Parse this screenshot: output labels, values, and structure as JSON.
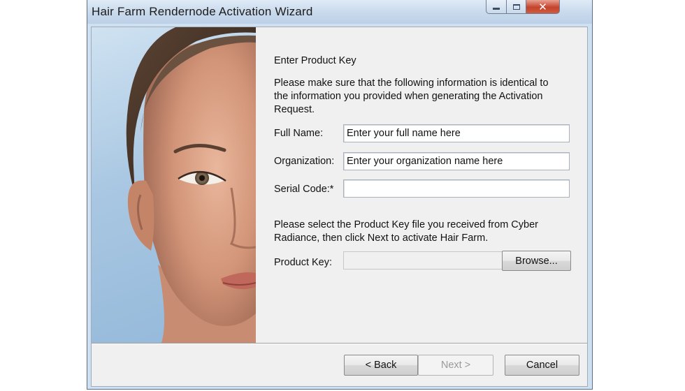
{
  "window": {
    "title": "Hair Farm Rendernode Activation Wizard",
    "close_glyph": "✕"
  },
  "header": {
    "heading": "Enter Product Key",
    "info_line1": "Please make sure that the following information is identical to",
    "info_line2": "the information you provided when generating the Activation",
    "info_line3": "Request."
  },
  "form": {
    "full_name_label": "Full Name:",
    "full_name_value": "Enter your full name here",
    "organization_label": "Organization:",
    "organization_value": "Enter your organization name here",
    "serial_label": "Serial Code:*",
    "serial_value": ""
  },
  "product_key": {
    "instruction_line1": "Please select the Product Key file you received from Cyber",
    "instruction_line2": "Radiance, then click Next to activate Hair Farm.",
    "label": "Product Key:",
    "value": "",
    "browse_label": "Browse..."
  },
  "footer": {
    "back_label": "< Back",
    "next_label": "Next >",
    "cancel_label": "Cancel"
  },
  "colors": {
    "title_bar": "#c8d9ec",
    "client_bg": "#f0f0f0",
    "close_button": "#c4432c"
  },
  "icons": {
    "minimize": "minimize-icon",
    "maximize": "maximize-icon",
    "close": "close-icon"
  }
}
